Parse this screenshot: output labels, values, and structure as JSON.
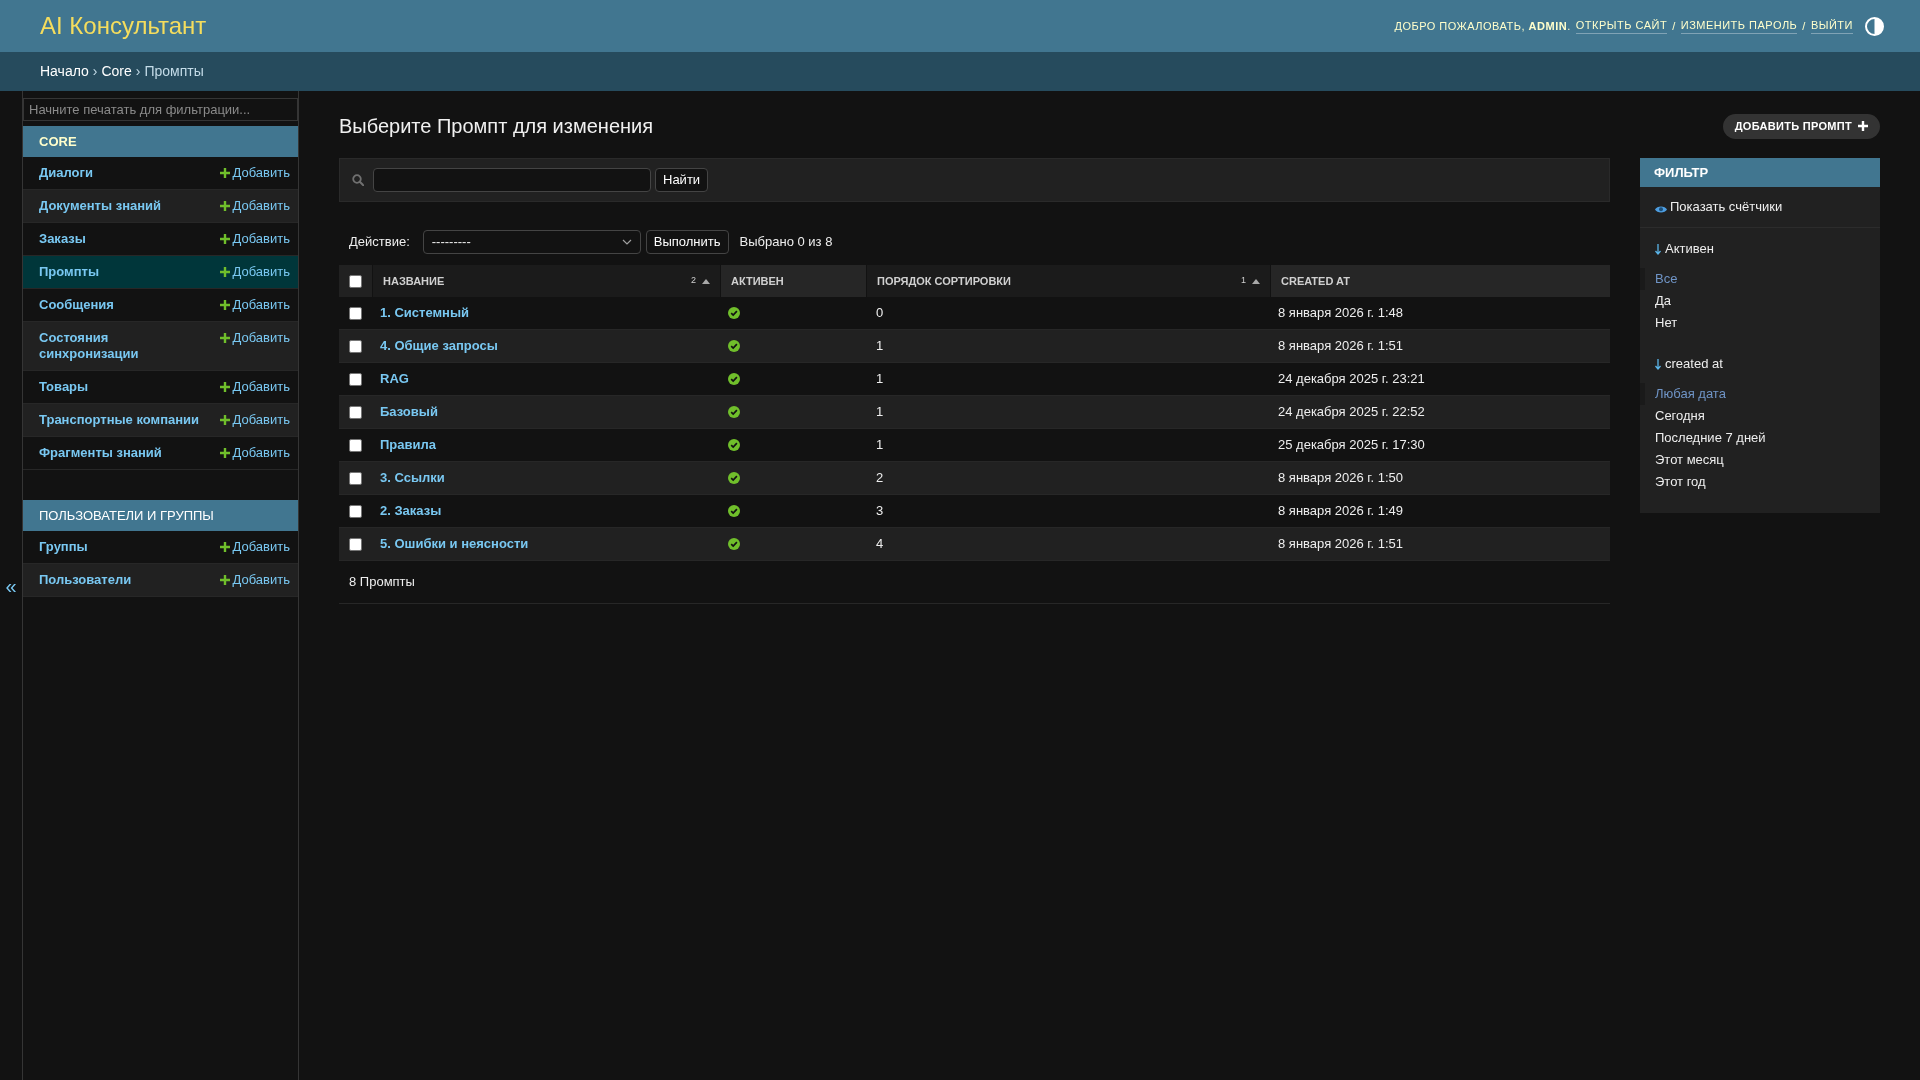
{
  "header": {
    "site_title": "AI Консультант",
    "welcome": "ДОБРО ПОЖАЛОВАТЬ, **ADMIN**.",
    "user_links": [
      {
        "kind": "link",
        "label": "ОТКРЫТЬ САЙТ"
      },
      {
        "kind": "separator",
        "label": "/"
      },
      {
        "kind": "link",
        "label": "ИЗМЕНИТЬ ПАРОЛЬ"
      },
      {
        "kind": "separator",
        "label": "/"
      },
      {
        "kind": "link",
        "label": "ВЫЙТИ"
      }
    ]
  },
  "breadcrumbs": [
    {
      "kind": "link",
      "label": "Начало"
    },
    {
      "kind": "separator",
      "label": "›"
    },
    {
      "kind": "link",
      "label": "Core"
    },
    {
      "kind": "separator",
      "label": "›"
    },
    {
      "kind": "current",
      "label": "Промпты"
    }
  ],
  "sidebar": {
    "toggle": "«",
    "filter": {
      "placeholder": "Начните печатать для фильтрации..."
    },
    "modules": [
      {
        "title": "CORE",
        "current": true,
        "items": [
          {
            "label": "Диалоги",
            "add": "Добавить",
            "selected": false
          },
          {
            "label": "Документы знаний",
            "add": "Добавить",
            "selected": false
          },
          {
            "label": "Заказы",
            "add": "Добавить",
            "selected": false
          },
          {
            "label": "Промпты",
            "add": "Добавить",
            "selected": true
          },
          {
            "label": "Сообщения",
            "add": "Добавить",
            "selected": false
          },
          {
            "label": "Состояния синхронизации",
            "add": "Добавить",
            "selected": false
          },
          {
            "label": "Товары",
            "add": "Добавить",
            "selected": false
          },
          {
            "label": "Транспортные компании",
            "add": "Добавить",
            "selected": false
          },
          {
            "label": "Фрагменты знаний",
            "add": "Добавить",
            "selected": false
          }
        ]
      },
      {
        "title": "ПОЛЬЗОВАТЕЛИ И ГРУППЫ",
        "current": false,
        "items": [
          {
            "label": "Группы",
            "add": "Добавить",
            "selected": false
          },
          {
            "label": "Пользователи",
            "add": "Добавить",
            "selected": false
          }
        ]
      }
    ]
  },
  "page": {
    "title": "Выберите Промпт для изменения",
    "add_button": "ДОБАВИТЬ ПРОМПТ"
  },
  "search": {
    "button": "Найти"
  },
  "actions": {
    "label": "Действие:",
    "select_value": "---------",
    "button": "Выполнить",
    "counter": "Выбрано 0 из 8"
  },
  "table": {
    "select_all": {
      "checked": false
    },
    "columns": [
      {
        "label": "НАЗВАНИЕ",
        "sorted": true,
        "sort_priority": "2"
      },
      {
        "label": "АКТИВЕН",
        "sorted": false
      },
      {
        "label": "ПОРЯДОК СОРТИРОВКИ",
        "sorted": true,
        "sort_priority": "1"
      },
      {
        "label": "CREATED AT",
        "sorted": false
      }
    ],
    "rows": [
      {
        "selected": false,
        "name": "1. Системный",
        "active": true,
        "sort_order": "0",
        "created_at": "8 января 2026 г. 1:48"
      },
      {
        "selected": false,
        "name": "4. Общие запросы",
        "active": true,
        "sort_order": "1",
        "created_at": "8 января 2026 г. 1:51"
      },
      {
        "selected": false,
        "name": "RAG",
        "active": true,
        "sort_order": "1",
        "created_at": "24 декабря 2025 г. 23:21"
      },
      {
        "selected": false,
        "name": "Базовый",
        "active": true,
        "sort_order": "1",
        "created_at": "24 декабря 2025 г. 22:52"
      },
      {
        "selected": false,
        "name": "Правила",
        "active": true,
        "sort_order": "1",
        "created_at": "25 декабря 2025 г. 17:30"
      },
      {
        "selected": false,
        "name": "3. Ссылки",
        "active": true,
        "sort_order": "2",
        "created_at": "8 января 2026 г. 1:50"
      },
      {
        "selected": false,
        "name": "2. Заказы",
        "active": true,
        "sort_order": "3",
        "created_at": "8 января 2026 г. 1:49"
      },
      {
        "selected": false,
        "name": "5. Ошибки и неясности",
        "active": true,
        "sort_order": "4",
        "created_at": "8 января 2026 г. 1:51"
      }
    ],
    "footer": "8 Промпты"
  },
  "filter": {
    "title": "ФИЛЬТР",
    "show_counts": "Показать счётчики",
    "groups": [
      {
        "title": "Активен",
        "options": [
          {
            "label": "Все",
            "selected": true
          },
          {
            "label": "Да",
            "selected": false
          },
          {
            "label": "Нет",
            "selected": false
          }
        ]
      },
      {
        "title": "created at",
        "options": [
          {
            "label": "Любая дата",
            "selected": true
          },
          {
            "label": "Сегодня",
            "selected": false
          },
          {
            "label": "Последние 7 дней",
            "selected": false
          },
          {
            "label": "Этот месяц",
            "selected": false
          },
          {
            "label": "Этот год",
            "selected": false
          }
        ]
      }
    ]
  }
}
